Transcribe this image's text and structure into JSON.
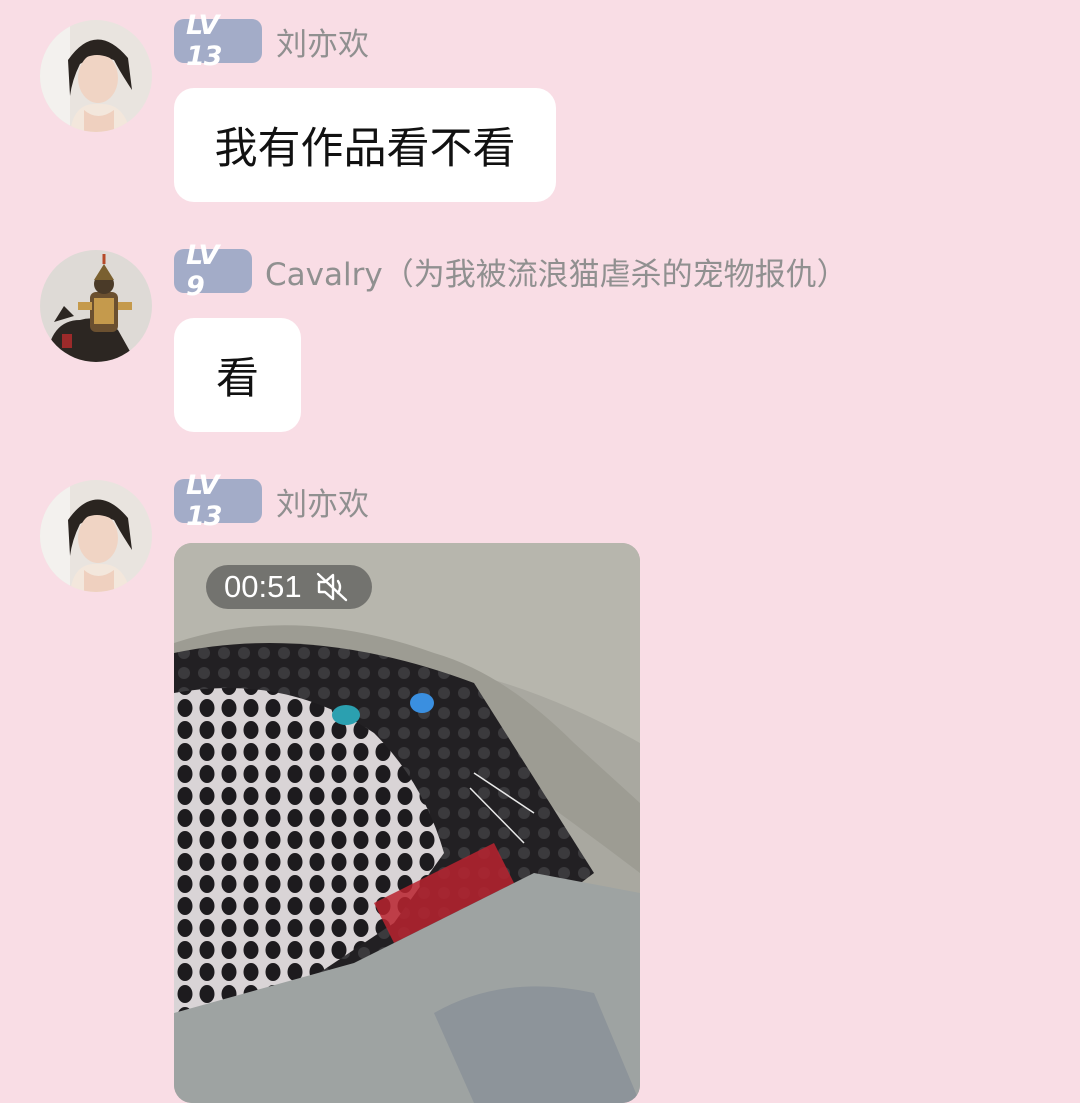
{
  "messages": [
    {
      "avatar_icon": "woman-portrait-avatar",
      "level": "LV 13",
      "username": "刘亦欢",
      "text": "我有作品看不看"
    },
    {
      "avatar_icon": "armored-cavalry-rider-avatar",
      "level": "LV 9",
      "username": "Cavalry（为我被流浪猫虐杀的宠物报仇）",
      "text": "看"
    },
    {
      "avatar_icon": "woman-portrait-avatar",
      "level": "LV 13",
      "username": "刘亦欢",
      "video": {
        "duration": "00:51",
        "muted_icon": "speaker-muted-icon",
        "thumbnail": "cat-in-mesh-bag-thumbnail"
      }
    }
  ],
  "colors": {
    "background": "#f9dde5",
    "level_badge": "#a3acc8",
    "username": "#909090",
    "bubble": "#ffffff"
  }
}
